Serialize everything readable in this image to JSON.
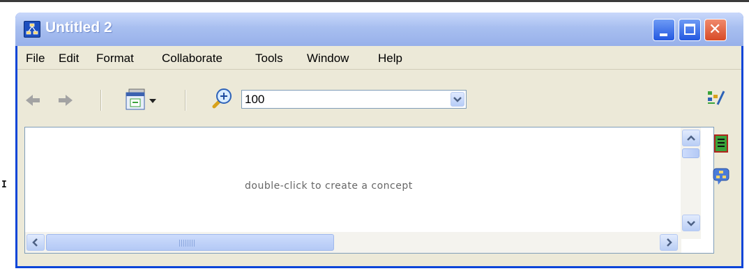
{
  "background": {
    "edge_text": "I"
  },
  "window": {
    "title": "Untitled 2",
    "controls": {
      "minimize": "minimize",
      "maximize": "maximize",
      "close": "close"
    }
  },
  "menu": {
    "items": [
      "File",
      "Edit",
      "Format",
      "Collaborate",
      "Tools",
      "Window",
      "Help"
    ]
  },
  "toolbar": {
    "zoom_value": "100",
    "icons": [
      "back-arrow-icon",
      "forward-arrow-icon",
      "view-dropdown-icon",
      "zoom-in-icon"
    ]
  },
  "canvas": {
    "hint": "double-click to create a concept"
  },
  "side_panel": {
    "icons": [
      "styles-icon",
      "list-icon",
      "discussion-icon"
    ]
  },
  "colors": {
    "title_bar": "#a8bff0",
    "window_border": "#0b45d8",
    "chrome": "#ece9d8",
    "scrollbar": "#b9cef5",
    "close_button": "#d74a27"
  }
}
